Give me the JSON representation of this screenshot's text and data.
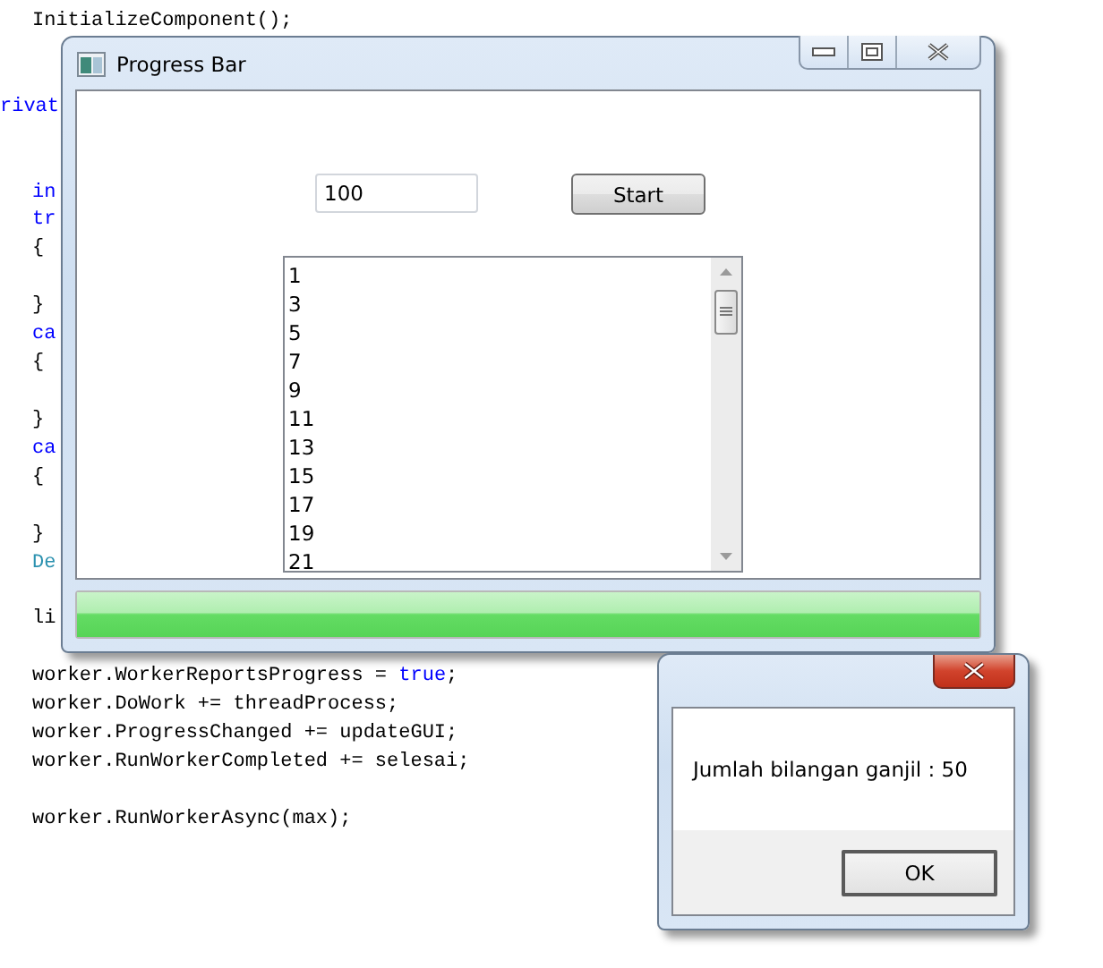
{
  "editor": {
    "lines": [
      {
        "kind": "inner",
        "tokens": [
          {
            "kind": "plain",
            "text": "InitializeComponent();"
          }
        ]
      },
      {
        "kind": "blank"
      },
      {
        "kind": "blank"
      },
      {
        "kind": "outer",
        "tokens": [
          {
            "kind": "keyword",
            "text": "rivat"
          }
        ]
      },
      {
        "kind": "blank"
      },
      {
        "kind": "blank"
      },
      {
        "kind": "inner",
        "tokens": [
          {
            "kind": "keyword",
            "text": "in"
          }
        ]
      },
      {
        "kind": "inner",
        "tokens": [
          {
            "kind": "keyword",
            "text": "tr"
          }
        ]
      },
      {
        "kind": "inner",
        "tokens": [
          {
            "kind": "plain",
            "text": "{"
          }
        ]
      },
      {
        "kind": "blank"
      },
      {
        "kind": "inner",
        "tokens": [
          {
            "kind": "plain",
            "text": "}"
          }
        ]
      },
      {
        "kind": "inner",
        "tokens": [
          {
            "kind": "keyword",
            "text": "ca"
          }
        ]
      },
      {
        "kind": "inner",
        "tokens": [
          {
            "kind": "plain",
            "text": "{"
          }
        ]
      },
      {
        "kind": "blank"
      },
      {
        "kind": "inner",
        "tokens": [
          {
            "kind": "plain",
            "text": "}"
          }
        ]
      },
      {
        "kind": "inner",
        "tokens": [
          {
            "kind": "keyword",
            "text": "ca"
          }
        ]
      },
      {
        "kind": "inner",
        "tokens": [
          {
            "kind": "plain",
            "text": "{"
          }
        ]
      },
      {
        "kind": "blank"
      },
      {
        "kind": "inner",
        "tokens": [
          {
            "kind": "plain",
            "text": "}"
          }
        ]
      },
      {
        "kind": "inner",
        "tokens": [
          {
            "kind": "type",
            "text": "De"
          }
        ]
      },
      {
        "kind": "blank"
      },
      {
        "kind": "inner",
        "tokens": [
          {
            "kind": "plain",
            "text": "li"
          }
        ]
      },
      {
        "kind": "blank"
      },
      {
        "kind": "inner",
        "tokens": [
          {
            "kind": "plain",
            "text": "worker.WorkerReportsProgress = "
          },
          {
            "kind": "keyword",
            "text": "true"
          },
          {
            "kind": "plain",
            "text": ";"
          }
        ]
      },
      {
        "kind": "inner",
        "tokens": [
          {
            "kind": "plain",
            "text": "worker.DoWork += threadProcess;"
          }
        ]
      },
      {
        "kind": "inner",
        "tokens": [
          {
            "kind": "plain",
            "text": "worker.ProgressChanged += updateGUI;"
          }
        ]
      },
      {
        "kind": "inner",
        "tokens": [
          {
            "kind": "plain",
            "text": "worker.RunWorkerCompleted += selesai;"
          }
        ]
      },
      {
        "kind": "blank"
      },
      {
        "kind": "inner",
        "tokens": [
          {
            "kind": "plain",
            "text": "worker.RunWorkerAsync(max);"
          }
        ]
      }
    ]
  },
  "main_window": {
    "title": "Progress Bar",
    "number_field": {
      "value": "100"
    },
    "start_button": "Start",
    "list": {
      "items": [
        "1",
        "3",
        "5",
        "7",
        "9",
        "11",
        "13",
        "15",
        "17",
        "19",
        "21"
      ]
    },
    "progress": {
      "level": 1
    }
  },
  "message_box": {
    "message": "Jumlah bilangan ganjil : 50",
    "ok_button": "OK"
  }
}
